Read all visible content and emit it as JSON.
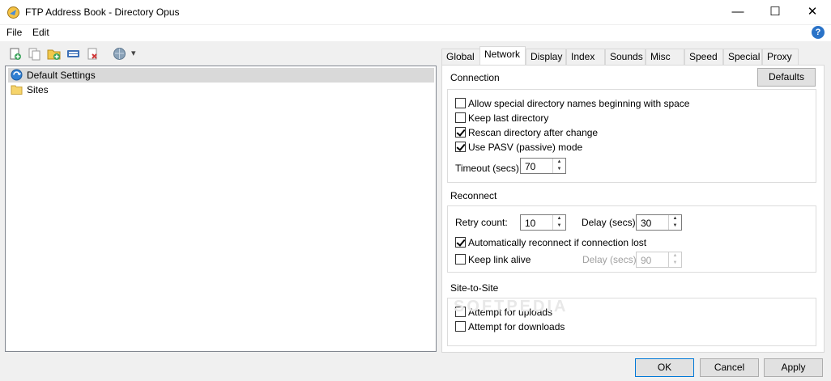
{
  "window": {
    "title": "FTP Address Book - Directory Opus",
    "minimize_glyph": "—",
    "maximize_glyph": "☐",
    "close_glyph": "✕"
  },
  "menu": {
    "items": [
      "File",
      "Edit"
    ],
    "help_glyph": "?"
  },
  "toolbar": {
    "icons": [
      "new-site-icon",
      "copy-site-icon",
      "new-folder-icon",
      "properties-icon",
      "delete-icon",
      "connect-icon"
    ],
    "dropdown_glyph": "▾"
  },
  "tree": {
    "items": [
      {
        "label": "Default Settings",
        "icon": "settings-globe-icon",
        "selected": true
      },
      {
        "label": "Sites",
        "icon": "folder-icon",
        "selected": false
      }
    ]
  },
  "tabs": [
    "Global",
    "Network",
    "Display",
    "Index",
    "Sounds",
    "Misc",
    "Speed",
    "Special",
    "Proxy"
  ],
  "active_tab": "Network",
  "connection": {
    "label": "Connection",
    "defaults_button": "Defaults",
    "options": [
      {
        "label": "Allow special directory names beginning with space",
        "checked": false
      },
      {
        "label": "Keep last directory",
        "checked": false
      },
      {
        "label": "Rescan directory after change",
        "checked": true
      },
      {
        "label": "Use PASV (passive) mode",
        "checked": true
      }
    ],
    "timeout_label": "Timeout (secs):",
    "timeout_value": "70"
  },
  "reconnect": {
    "label": "Reconnect",
    "retry_label": "Retry count:",
    "retry_value": "10",
    "delay_label": "Delay (secs):",
    "delay_value": "30",
    "auto_reconnect_label": "Automatically reconnect if connection lost",
    "auto_reconnect_checked": true,
    "keep_alive_label": "Keep link alive",
    "keep_alive_checked": false,
    "keep_alive_delay_label": "Delay (secs):",
    "keep_alive_delay_value": "90"
  },
  "site_to_site": {
    "label": "Site-to-Site",
    "uploads_label": "Attempt for uploads",
    "uploads_checked": false,
    "downloads_label": "Attempt for downloads",
    "downloads_checked": false
  },
  "watermark": "SOFTPEDIA",
  "buttons": {
    "ok": "OK",
    "cancel": "Cancel",
    "apply": "Apply"
  },
  "colors": {
    "accent": "#0078d7",
    "selection": "#d9d9d9",
    "help": "#2a73c8"
  }
}
